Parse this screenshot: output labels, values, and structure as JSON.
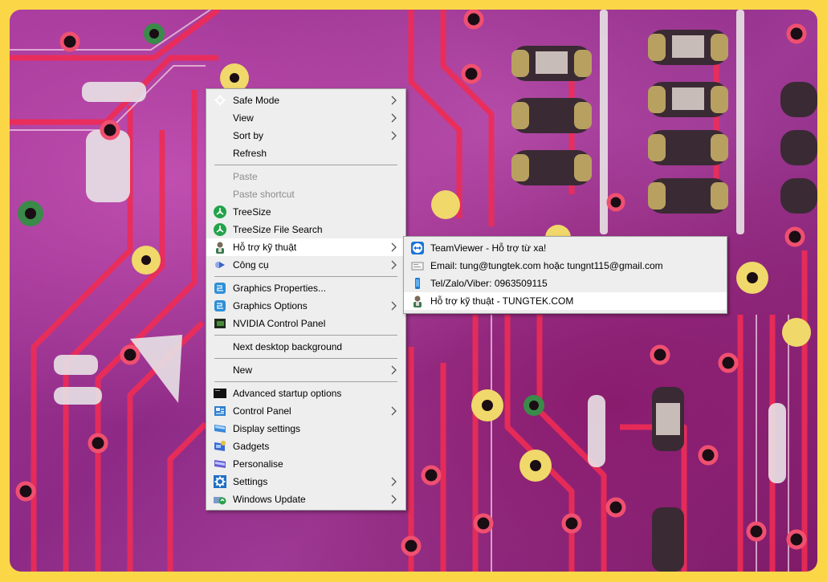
{
  "context_menu": {
    "items": [
      {
        "label": "Safe Mode",
        "icon": "safe-mode-icon",
        "submenu": true
      },
      {
        "label": "View",
        "submenu": true
      },
      {
        "label": "Sort by",
        "submenu": true
      },
      {
        "label": "Refresh"
      },
      {
        "separator": true
      },
      {
        "label": "Paste",
        "disabled": true
      },
      {
        "label": "Paste shortcut",
        "disabled": true
      },
      {
        "label": "TreeSize",
        "icon": "treesize-icon"
      },
      {
        "label": "TreeSize File Search",
        "icon": "treesize-icon"
      },
      {
        "label": "Hỗ trợ kỹ thuật",
        "icon": "support-person-icon",
        "submenu": true,
        "highlighted": true
      },
      {
        "label": "Công cụ",
        "icon": "tools-icon",
        "submenu": true
      },
      {
        "separator": true
      },
      {
        "label": "Graphics Properties...",
        "icon": "intel-graphics-icon"
      },
      {
        "label": "Graphics Options",
        "icon": "intel-graphics-icon",
        "submenu": true
      },
      {
        "label": "NVIDIA Control Panel",
        "icon": "nvidia-icon"
      },
      {
        "separator": true
      },
      {
        "label": "Next desktop background"
      },
      {
        "separator": true
      },
      {
        "label": "New",
        "submenu": true
      },
      {
        "separator": true
      },
      {
        "label": "Advanced startup options",
        "icon": "cmd-icon"
      },
      {
        "label": "Control Panel",
        "icon": "control-panel-icon",
        "submenu": true
      },
      {
        "label": "Display settings",
        "icon": "display-icon"
      },
      {
        "label": "Gadgets",
        "icon": "gadgets-icon"
      },
      {
        "label": "Personalise",
        "icon": "personalise-icon"
      },
      {
        "label": "Settings",
        "icon": "gear-icon",
        "submenu": true
      },
      {
        "label": "Windows Update",
        "icon": "windows-update-icon",
        "submenu": true
      }
    ]
  },
  "support_submenu": {
    "items": [
      {
        "label": "TeamViewer - Hỗ trợ từ xa!",
        "icon": "teamviewer-icon"
      },
      {
        "label": "Email: tung@tungtek.com hoặc tungnt115@gmail.com",
        "icon": "email-icon"
      },
      {
        "label": "Tel/Zalo/Viber: 0963509115",
        "icon": "phone-icon"
      },
      {
        "label": "Hỗ trợ kỹ thuật - TUNGTEK.COM",
        "icon": "support-person-icon",
        "highlighted": true
      }
    ]
  },
  "colors": {
    "frame": "#fbd748",
    "menu_bg": "#eeeeee",
    "highlight": "#ffffff",
    "disabled_text": "#8c8c8c",
    "pcb_trace": "#e8264f",
    "pcb_board": "#9b3590"
  }
}
